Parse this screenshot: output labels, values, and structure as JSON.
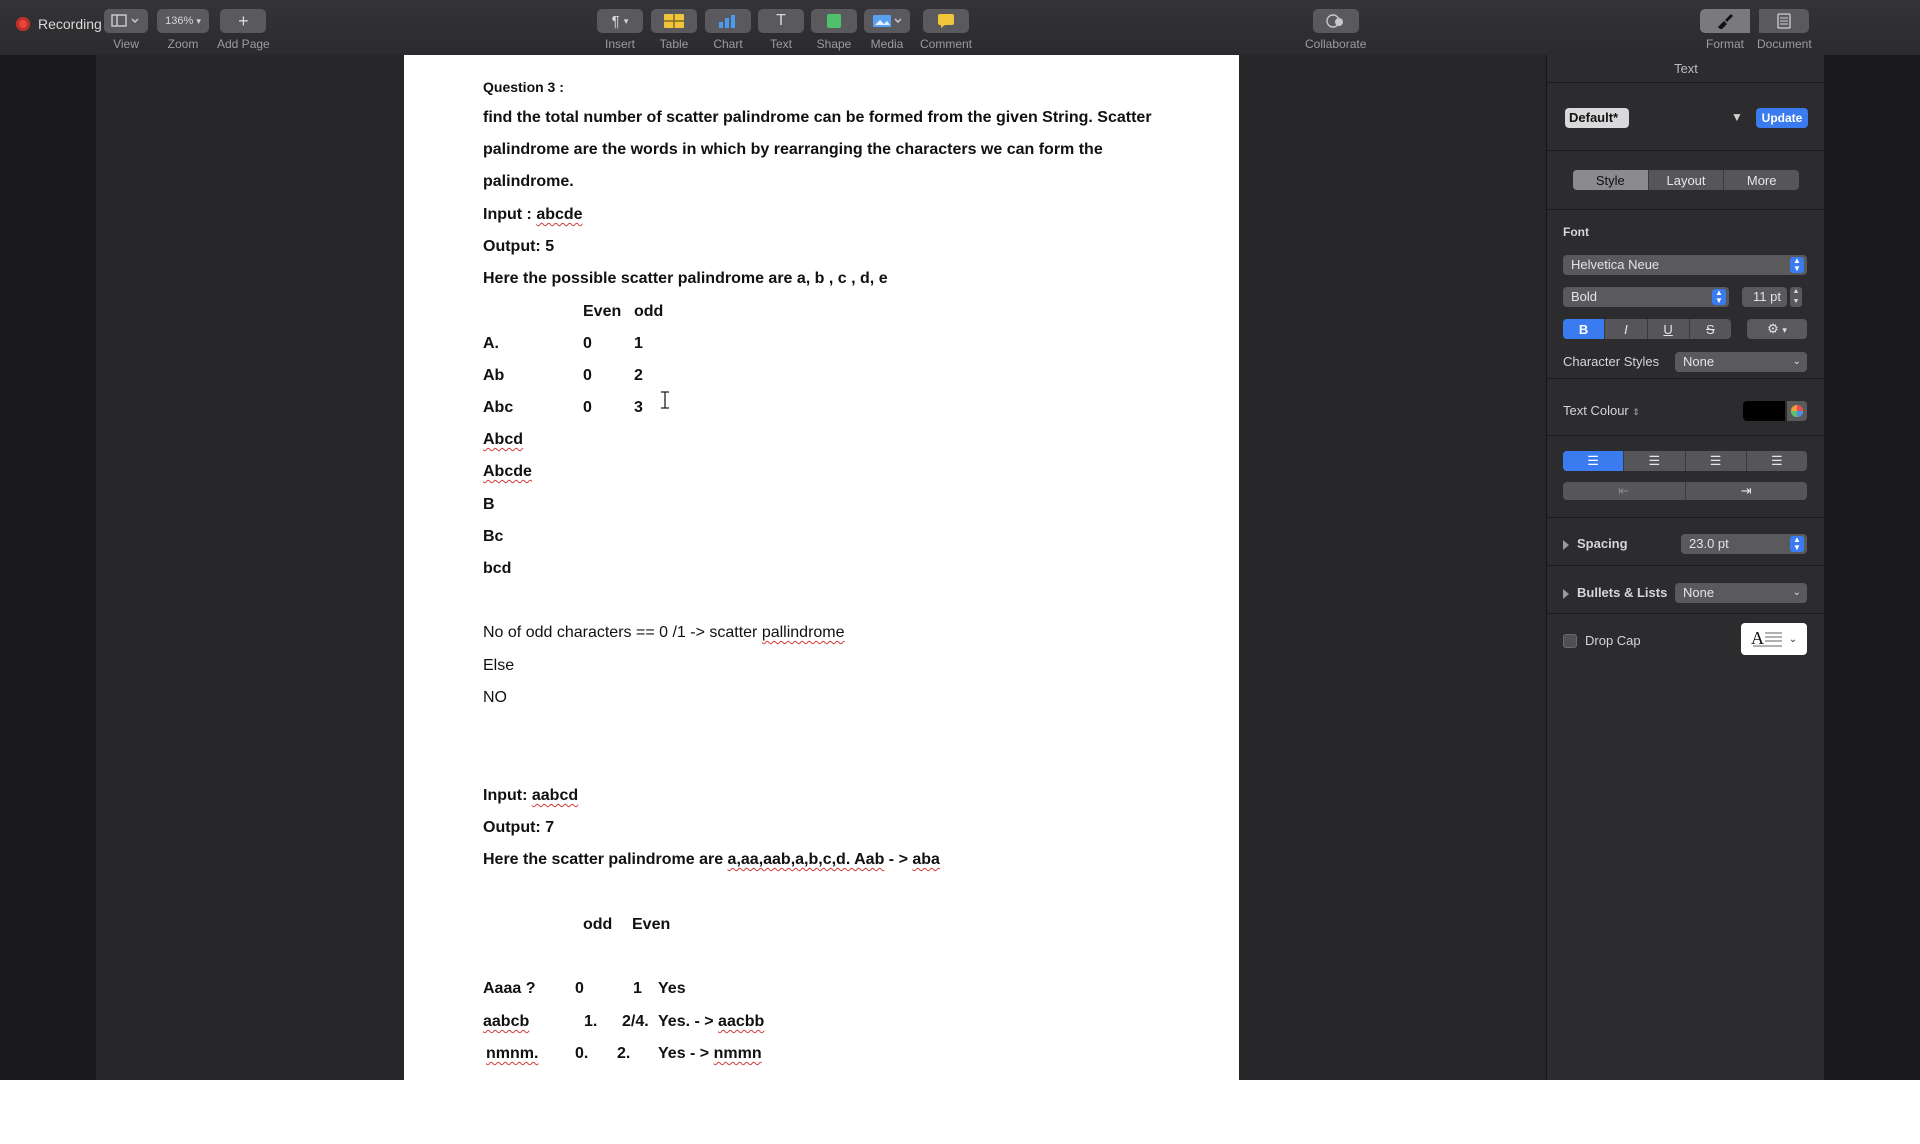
{
  "recording": {
    "label": "Recording"
  },
  "toolbar": {
    "view_label": "View",
    "zoom_value": "136%",
    "zoom_label": "Zoom",
    "add_page_label": "Add Page",
    "insert_label": "Insert",
    "table_label": "Table",
    "chart_label": "Chart",
    "text_label": "Text",
    "shape_label": "Shape",
    "media_label": "Media",
    "comment_label": "Comment",
    "collaborate_label": "Collaborate",
    "format_label": "Format",
    "document_label": "Document"
  },
  "document": {
    "q_title": "Question 3 :",
    "p1": "find the total number of scatter palindrome can be formed from the given String. Scatter",
    "p2": "palindrome are the words in which by rearranging the characters we can form the",
    "p3": "palindrome.",
    "in1_label": "Input : ",
    "in1_value": "abcde",
    "out1": "Output: 5",
    "here1": "Here the possible scatter palindrome are a, b , c , d, e",
    "t1_header": [
      "Even",
      "odd"
    ],
    "t1_rows": [
      {
        "word": "A.",
        "even": "0",
        "odd": "1"
      },
      {
        "word": "Ab",
        "even": "0",
        "odd": "2"
      },
      {
        "word": "Abc",
        "even": "0",
        "odd": "3"
      }
    ],
    "words": [
      "Abcd",
      "Abcde",
      "B",
      "Bc",
      "bcd"
    ],
    "rule1_a": "No of odd characters == 0 /1 -> scatter ",
    "rule1_b": "pallindrome",
    "rule_else": "Else",
    "rule_no": "NO",
    "in2_label": "Input: ",
    "in2_value": "aabcd",
    "out2": "Output: 7",
    "here2_a": "Here the scatter palindrome are ",
    "here2_b": "a,aa,aab,a,b,c,d. Aab",
    "here2_c": " - > ",
    "here2_d": "aba",
    "t2_header": [
      "odd",
      "Even"
    ],
    "t2_rows": [
      {
        "word": "Aaaa ?",
        "odd": "0",
        "even": "1",
        "result": "Yes",
        "note": ""
      },
      {
        "word": "aabcb",
        "odd": "1.",
        "even": "2/4.",
        "result": "Yes. - > ",
        "note": "aacbb"
      },
      {
        "word": "nmnm.",
        "odd": "0.",
        "even": "2.",
        "result": "Yes - > ",
        "note": "nmmn"
      }
    ]
  },
  "inspector": {
    "header": "Text",
    "style_name": "Default*",
    "update_label": "Update",
    "tabs": [
      "Style",
      "Layout",
      "More"
    ],
    "font_label": "Font",
    "font_family": "Helvetica Neue",
    "font_weight": "Bold",
    "font_size": "11 pt",
    "format_buttons": [
      "B",
      "I",
      "U",
      "S"
    ],
    "char_styles_label": "Character Styles",
    "char_styles_value": "None",
    "text_colour_label": "Text Colour",
    "text_colour": "#000000",
    "spacing_label": "Spacing",
    "spacing_value": "23.0 pt",
    "bullets_label": "Bullets & Lists",
    "bullets_value": "None",
    "drop_cap_label": "Drop Cap"
  }
}
